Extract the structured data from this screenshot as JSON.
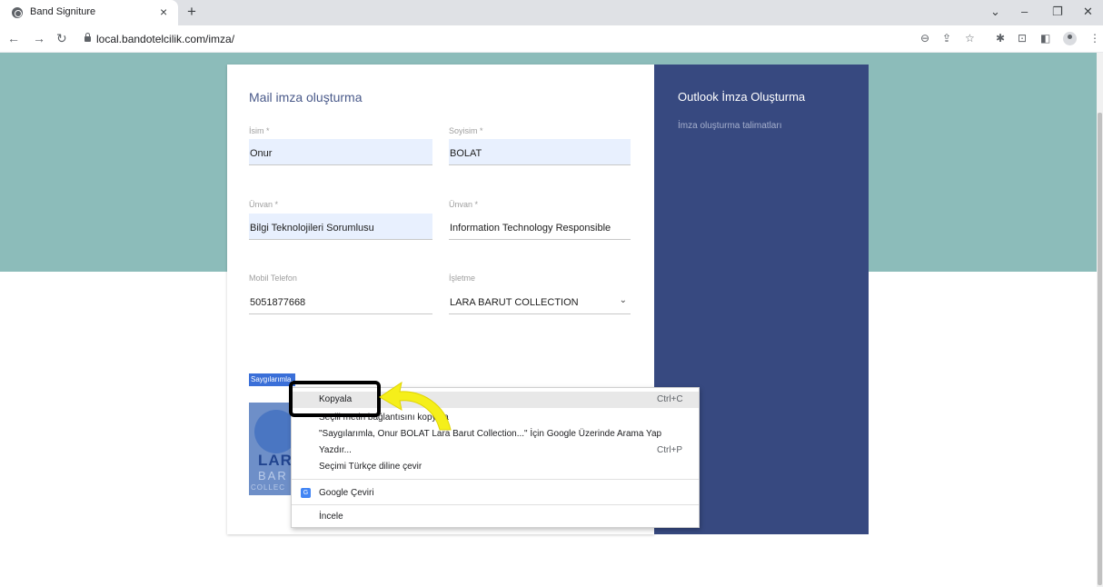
{
  "browser": {
    "tab_title": "Band Signiture",
    "tab_close": "×",
    "new_tab": "+",
    "url": "local.bandotelcilik.com/imza/",
    "icons": [
      "back-icon",
      "forward-icon",
      "reload-icon",
      "lock-icon",
      "zoom-icon",
      "share-icon",
      "star-icon",
      "extensions-icon",
      "cast-icon",
      "sidepanel-icon",
      "profile-icon",
      "menu-icon"
    ]
  },
  "form": {
    "title": "Mail imza oluşturma",
    "isim_label": "İsim *",
    "isim_value": "Onur",
    "soyisim_label": "Soyisim *",
    "soyisim_value": "BOLAT",
    "unvan_label": "Ünvan *",
    "unvan_value": "Bilgi Teknolojileri Sorumlusu",
    "unvan_en_label": "Ünvan *",
    "unvan_en_value": "Information Technology  Responsible",
    "mobil_label": "Mobil Telefon",
    "mobil_value": "5051877668",
    "isletme_label": "İşletme",
    "isletme_value": "LARA BARUT COLLECTION",
    "signature_text": "Saygılarımla,",
    "logo_line1": "LAR",
    "logo_line2": "BAR",
    "logo_line3": "COLLEC"
  },
  "side_panel": {
    "title": "Outlook İmza Oluşturma",
    "subtitle": "İmza oluşturma talimatları"
  },
  "context_menu": {
    "items": [
      {
        "label": "Kopyala",
        "shortcut": "Ctrl+C"
      },
      {
        "label": "Seçili metin bağlantısını kopyala",
        "shortcut": ""
      },
      {
        "label": "\"Saygılarımla,   Onur BOLAT Lara Barut Collection...\" İçin Google Üzerinde Arama Yap",
        "shortcut": ""
      },
      {
        "label": "Yazdır...",
        "shortcut": "Ctrl+P"
      },
      {
        "label": "Seçimi Türkçe diline çevir",
        "shortcut": ""
      },
      {
        "label": "Google Çeviri",
        "shortcut": ""
      },
      {
        "label": "İncele",
        "shortcut": ""
      }
    ]
  },
  "colors": {
    "teal_band": "#8cbcba",
    "side_panel": "#374980",
    "highlight": "#3a6fd8",
    "annotation_arrow": "#f5ef1a"
  }
}
